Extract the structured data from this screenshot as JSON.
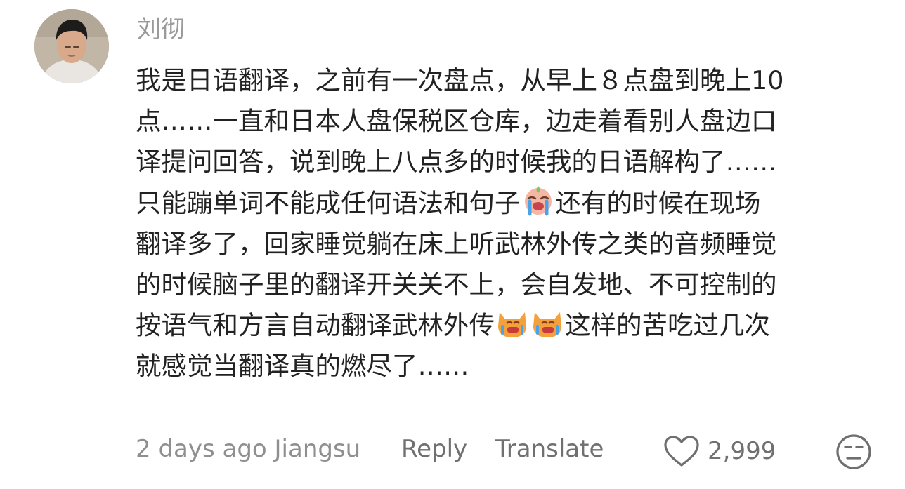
{
  "comment": {
    "author": "刘彻",
    "lines": [
      {
        "text_a": "我是日语翻译，之前有一次盘点，从早上８点盘到晚上10",
        "text_b": ""
      },
      {
        "text_a": "点……一直和日本人盘保税区仓库，边走着看别人盘边口",
        "text_b": ""
      },
      {
        "text_a": "译提问回答，说到晚上八点多的时候我的日语解构了……",
        "text_b": ""
      },
      {
        "text_a": "只能蹦单词不能成任何语法和句子",
        "text_b": "还有的时候在现场"
      },
      {
        "text_a": "翻译多了，回家睡觉躺在床上听武林外传之类的音频睡觉",
        "text_b": ""
      },
      {
        "text_a": "的时候脑子里的翻译开关关不上，会自发地、不可控制的",
        "text_b": ""
      },
      {
        "text_a": "按语气和方言自动翻译武林外传",
        "text_b": "这样的苦吃过几次"
      },
      {
        "text_a": "就感觉当翻译真的燃尽了……",
        "text_b": ""
      }
    ],
    "emojis": {
      "line4": "crying-face-emoji",
      "line7": [
        "crying-cat-emoji",
        "crying-cat-emoji"
      ]
    }
  },
  "footer": {
    "meta": "2 days ago Jiangsu",
    "reply": "Reply",
    "translate": "Translate",
    "likes": "2,999",
    "like_icon": "heart-icon",
    "dislike_icon": "unamused-face-icon"
  }
}
